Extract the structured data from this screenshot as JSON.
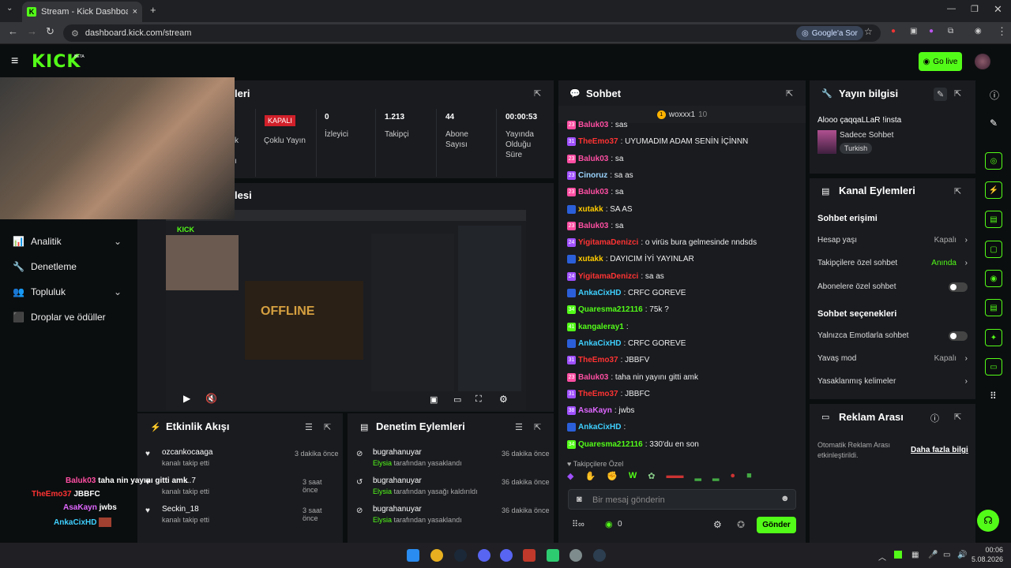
{
  "browser": {
    "tab_title": "Stream - Kick Dashboard",
    "tab_close": "×",
    "new_tab": "+",
    "url": "dashboard.kick.com/stream",
    "google_ask": "Google'a Sor"
  },
  "header": {
    "logo": "KICK",
    "beta": "BETA",
    "go_live": "Go live"
  },
  "sidebar": {
    "items": [
      {
        "label": "Analitik",
        "has_chevron": true
      },
      {
        "label": "Denetleme",
        "has_chevron": false
      },
      {
        "label": "Topluluk",
        "has_chevron": true
      },
      {
        "label": "Droplar ve ödüller",
        "has_chevron": false
      }
    ]
  },
  "stream_panel": {
    "title_partial": "leri",
    "video_title_partial": "lesi",
    "stats": [
      {
        "value": "KAPALI",
        "label": "Çoklu Yayın"
      },
      {
        "value": "0",
        "label": "İzleyici"
      },
      {
        "value": "1.213",
        "label": "Takipçi"
      },
      {
        "value": "44",
        "label": "Abone Sayısı"
      },
      {
        "value": "00:00:53",
        "label": "Yayında Olduğu Süre"
      }
    ],
    "left_partial": [
      "k",
      "ı"
    ]
  },
  "activity": {
    "title": "Etkinlik Akışı",
    "items": [
      {
        "user": "ozcankocaaga",
        "desc": "kanalı takip etti",
        "time": "3 dakika önce"
      },
      {
        "user": "...7",
        "desc": "kanalı takip etti",
        "time": "3 saat önce"
      },
      {
        "user": "Seckin_18",
        "desc": "kanalı takip etti",
        "time": "3 saat önce"
      }
    ]
  },
  "moderation": {
    "title": "Denetim Eylemleri",
    "items": [
      {
        "user": "bugrahanuyar",
        "actor": "Elysia",
        "desc": " tarafından yasaklandı",
        "time": "36 dakika önce"
      },
      {
        "user": "bugrahanuyar",
        "actor": "Elysia",
        "desc": " tarafından yasağı kaldırıldı",
        "time": "36 dakika önce"
      },
      {
        "user": "bugrahanuyar",
        "actor": "Elysia",
        "desc": " tarafından yasaklandı",
        "time": "36 dakika önce"
      }
    ]
  },
  "chat": {
    "title": "Sohbet",
    "pinned": "woxxx1",
    "pinned_count": "10",
    "messages": [
      {
        "badge": "23",
        "user": "Baluk03",
        "text": ": sas",
        "color": "ub"
      },
      {
        "badge": "31",
        "user": "TheEmo37",
        "text": ": UYUMADIM ADAM SENİN İÇİNNN",
        "color": "ur"
      },
      {
        "badge": "23",
        "user": "Baluk03",
        "text": ": sa",
        "color": "ub"
      },
      {
        "badge": "23",
        "user": "Cinoruz",
        "text": ": sa as",
        "color": "ul"
      },
      {
        "badge": "23",
        "user": "Baluk03",
        "text": ": sa",
        "color": "ub"
      },
      {
        "badge": "",
        "user": "xutakk",
        "text": ": SA AS",
        "color": "uy"
      },
      {
        "badge": "23",
        "user": "Baluk03",
        "text": ": sa",
        "color": "ub"
      },
      {
        "badge": "24",
        "user": "YigitamaDenizci",
        "text": ": o virüs bura gelmesinde nndsds",
        "color": "ur"
      },
      {
        "badge": "",
        "user": "xutakk",
        "text": ": DAYICIM İYİ YAYINLAR",
        "color": "uy"
      },
      {
        "badge": "24",
        "user": "YigitamaDenizci",
        "text": ": sa as",
        "color": "ur"
      },
      {
        "badge": "",
        "user": "AnkaCixHD",
        "text": ": CRFC GOREVE",
        "color": "ucy"
      },
      {
        "badge": "34",
        "user": "Quaresma212116",
        "text": ": 75k ?",
        "color": "ug"
      },
      {
        "badge": "41",
        "user": "kangaleray1",
        "text": ":",
        "color": "ug"
      },
      {
        "badge": "",
        "user": "AnkaCixHD",
        "text": ": CRFC GOREVE",
        "color": "ucy"
      },
      {
        "badge": "31",
        "user": "TheEmo37",
        "text": ": JBBFV",
        "color": "ur"
      },
      {
        "badge": "23",
        "user": "Baluk03",
        "text": ": taha nin yayını gitti amk",
        "color": "ub"
      },
      {
        "badge": "31",
        "user": "TheEmo37",
        "text": ": JBBFC",
        "color": "ur"
      },
      {
        "badge": "38",
        "user": "AsaKayn",
        "text": ": jwbs",
        "color": "upk"
      },
      {
        "badge": "",
        "user": "AnkaCixHD",
        "text": ":",
        "color": "ucy"
      },
      {
        "badge": "34",
        "user": "Quaresma212116",
        "text": ": 330'du en son",
        "color": "ug"
      }
    ],
    "followers_only": "Takipçilere Özel",
    "input_placeholder": "Bir mesaj gönderin",
    "count": "0",
    "send": "Gönder"
  },
  "stream_info": {
    "title": "Yayın bilgisi",
    "stream_title": "Alooo çaqqaLLaR !insta",
    "category": "Sadece Sohbet",
    "language": "Turkish"
  },
  "channel_actions": {
    "title": "Kanal Eylemleri",
    "chat_access": "Sohbet erişimi",
    "account_age": "Hesap yaşı",
    "account_age_val": "Kapalı",
    "followers_chat": "Takipçilere özel sohbet",
    "followers_chat_val": "Anında",
    "subs_chat": "Abonelere özel sohbet",
    "chat_options": "Sohbet seçenekleri",
    "emote_only": "Yalnızca Emotlarla sohbet",
    "slow_mode": "Yavaş mod",
    "slow_mode_val": "Kapalı",
    "banned_words": "Yasaklanmış kelimeler"
  },
  "ad_break": {
    "title": "Reklam Arası",
    "desc": "Otomatik Reklam Arası etkinleştirildi.",
    "more": "Daha fazla bilgi"
  },
  "overlay_chat": [
    {
      "user": "Baluk03",
      "text": "taha nin yayını gitti amk"
    },
    {
      "user": "TheEmo37",
      "text": "JBBFC"
    },
    {
      "user": "AsaKayn",
      "text": "jwbs"
    },
    {
      "user": "AnkaCixHD",
      "text": ""
    }
  ],
  "taskbar": {
    "time": "00:06",
    "date": "5.08.2026"
  },
  "colors": {
    "accent": "#53fc18",
    "panel": "#191b1f",
    "bg": "#0b0e0f",
    "live_off": "#d1202a"
  }
}
